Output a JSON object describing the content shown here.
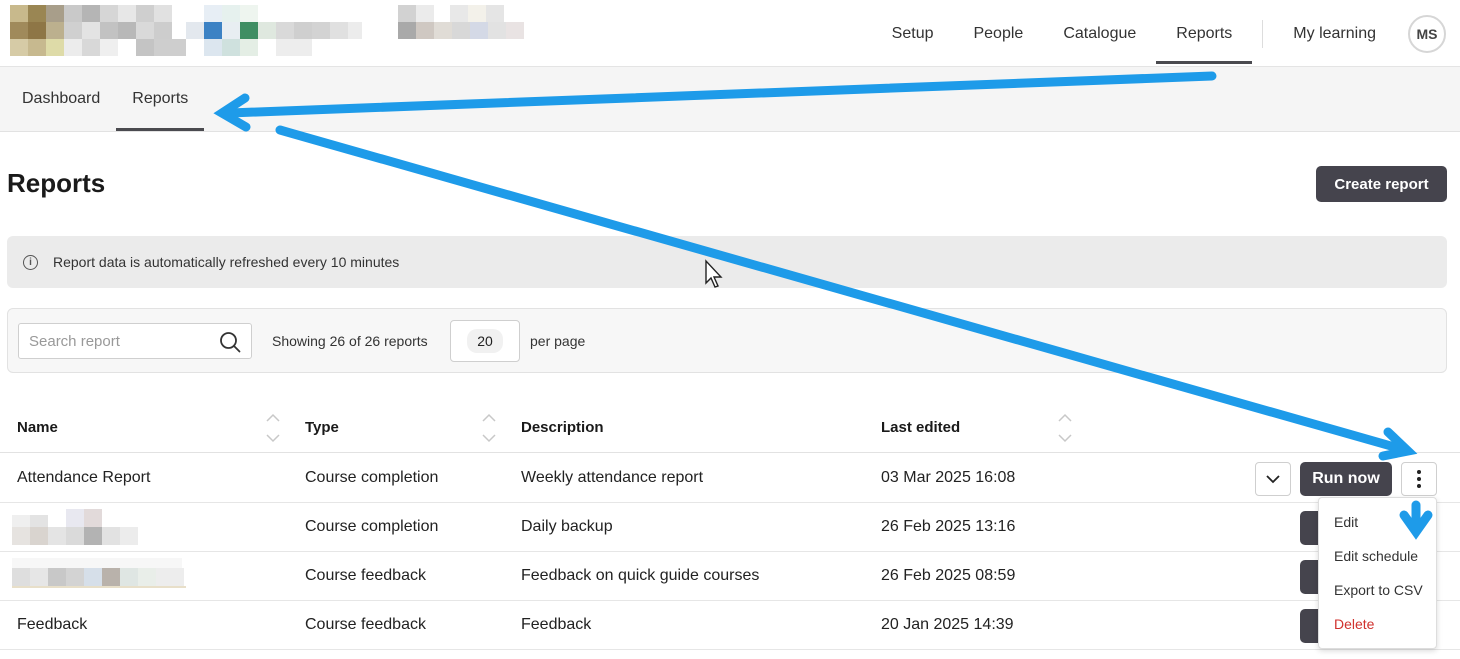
{
  "topnav": {
    "items": [
      {
        "label": "Setup",
        "active": false
      },
      {
        "label": "People",
        "active": false
      },
      {
        "label": "Catalogue",
        "active": false
      },
      {
        "label": "Reports",
        "active": true
      }
    ],
    "my_learning": "My learning",
    "avatar_initials": "MS"
  },
  "subnav": {
    "items": [
      {
        "label": "Dashboard",
        "active": false
      },
      {
        "label": "Reports",
        "active": true
      }
    ]
  },
  "page": {
    "title": "Reports",
    "create_button": "Create report"
  },
  "info_banner": {
    "icon": "info-icon",
    "text": "Report data is automatically refreshed every 10 minutes"
  },
  "filters": {
    "search_placeholder": "Search report",
    "search_value": "",
    "showing": "Showing 26 of 26 reports",
    "per_page_value": "20",
    "per_page_label": "per page"
  },
  "table": {
    "columns": [
      "Name",
      "Type",
      "Description",
      "Last edited"
    ],
    "rows": [
      {
        "name": "Attendance Report",
        "type": "Course completion",
        "description": "Weekly attendance report",
        "last_edited": "03 Mar 2025 16:08",
        "name_redacted": false
      },
      {
        "name": "",
        "type": "Course completion",
        "description": "Daily backup",
        "last_edited": "26 Feb 2025 13:16",
        "name_redacted": true
      },
      {
        "name": "",
        "type": "Course feedback",
        "description": "Feedback on quick guide courses",
        "last_edited": "26 Feb 2025 08:59",
        "name_redacted": true
      },
      {
        "name": "Feedback",
        "type": "Course feedback",
        "description": "Feedback",
        "last_edited": "20 Jan 2025 14:39",
        "name_redacted": false
      }
    ],
    "run_now_label": "Run now"
  },
  "row_menu": {
    "items": [
      {
        "label": "Edit",
        "danger": false
      },
      {
        "label": "Edit schedule",
        "danger": false
      },
      {
        "label": "Export to CSV",
        "danger": false
      },
      {
        "label": "Delete",
        "danger": true
      }
    ]
  },
  "colors": {
    "primary_button": "#45444d",
    "annotation_arrow": "#1e9be9",
    "danger": "#d0312d"
  }
}
